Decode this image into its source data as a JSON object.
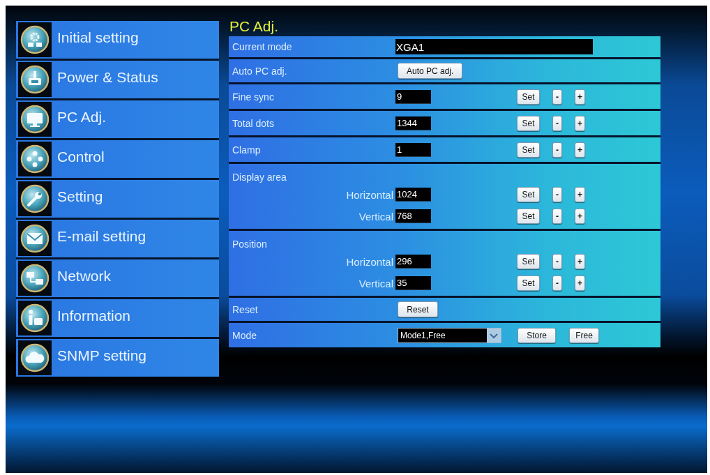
{
  "page": {
    "title": "PC Adj."
  },
  "sidebar": {
    "items": [
      "Initial setting",
      "Power & Status",
      "PC Adj.",
      "Control",
      "Setting",
      "E-mail setting",
      "Network",
      "Information",
      "SNMP setting"
    ]
  },
  "rows": [
    {
      "kind": "readout",
      "label": "Current mode",
      "value": "XGA1"
    },
    {
      "kind": "action",
      "label": "Auto PC adj.",
      "button": "Auto PC adj."
    },
    {
      "kind": "adjust",
      "label": "Fine sync",
      "value": "9",
      "buttons": [
        "Set",
        "-",
        "+"
      ]
    },
    {
      "kind": "adjust",
      "label": "Total dots",
      "value": "1344",
      "buttons": [
        "Set",
        "-",
        "+"
      ]
    },
    {
      "kind": "adjust",
      "label": "Clamp",
      "value": "1",
      "buttons": [
        "Set",
        "-",
        "+"
      ]
    },
    {
      "kind": "group",
      "label": "Display area",
      "items": [
        {
          "label": "Horizontal",
          "value": "1024",
          "buttons": [
            "Set",
            "-",
            "+"
          ]
        },
        {
          "label": "Vertical",
          "value": "768",
          "buttons": [
            "Set",
            "-",
            "+"
          ]
        }
      ]
    },
    {
      "kind": "group",
      "label": "Position",
      "items": [
        {
          "label": "Horizontal",
          "value": "296",
          "buttons": [
            "Set",
            "-",
            "+"
          ]
        },
        {
          "label": "Vertical",
          "value": "35",
          "buttons": [
            "Set",
            "-",
            "+"
          ]
        }
      ]
    },
    {
      "kind": "action",
      "label": "Reset",
      "button": "Reset"
    },
    {
      "kind": "mode",
      "label": "Mode",
      "select": "Mode1,Free",
      "buttons": [
        "Store",
        "Free"
      ]
    }
  ]
}
